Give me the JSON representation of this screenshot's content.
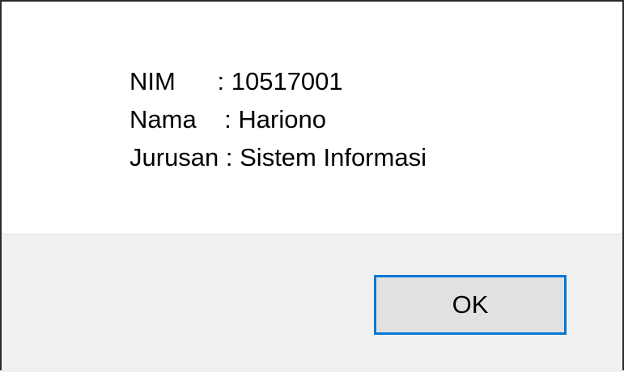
{
  "dialog": {
    "message_lines": [
      "NIM      : 10517001",
      "Nama    : Hariono",
      "Jurusan : Sistem Informasi"
    ],
    "ok_label": "OK"
  },
  "colors": {
    "button_focus_border": "#0078d7",
    "button_face": "#e1e1e1",
    "footer_background": "#f0f0f0"
  }
}
